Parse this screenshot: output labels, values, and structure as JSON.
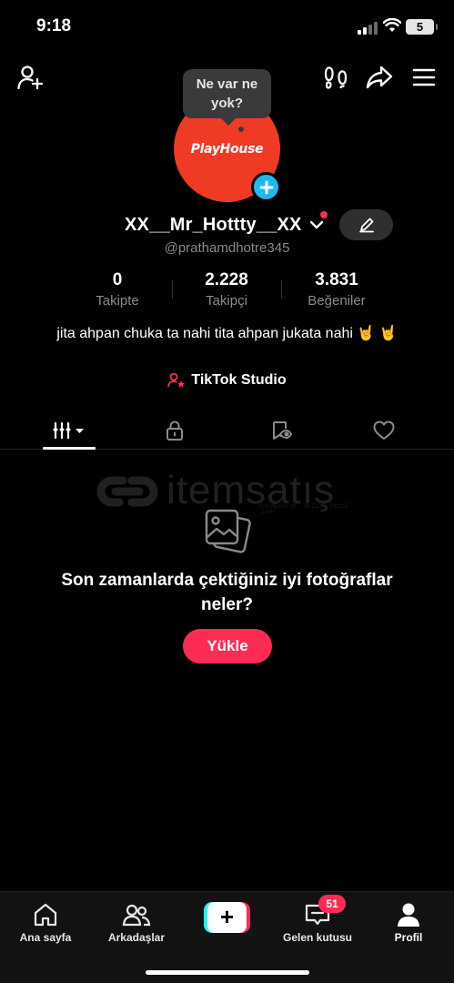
{
  "status_bar": {
    "time": "9:18",
    "battery": "5"
  },
  "profile": {
    "avatar_brand": "PlayHouse",
    "note_bubble": "Ne var ne yok?",
    "username": "XX__Mr_Hottty__XX",
    "handle": "@prathamdhotre345",
    "stats": [
      {
        "value": "0",
        "label": "Takipte"
      },
      {
        "value": "2.228",
        "label": "Takipçi"
      },
      {
        "value": "3.831",
        "label": "Beğeniler"
      }
    ],
    "bio": "jita ahpan chuka ta nahi tita ahpan jukata nahi 🤘 🤘",
    "studio_link": "TikTok Studio"
  },
  "watermark": {
    "text": "itemsatış",
    "sub": "GÜVENİLİR · HIZLI · UCUZ · .com"
  },
  "empty_state": {
    "title": "Son zamanlarda çektiğiniz iyi fotoğraflar neler?",
    "button": "Yükle"
  },
  "bottom_nav": {
    "home": "Ana sayfa",
    "friends": "Arkadaşlar",
    "inbox": "Gelen kutusu",
    "inbox_badge": "51",
    "profile": "Profil"
  },
  "colors": {
    "accent": "#fe2c55",
    "cyan": "#25f4ee",
    "avatar": "#ef3a24",
    "add_badge": "#1fb9f1"
  }
}
